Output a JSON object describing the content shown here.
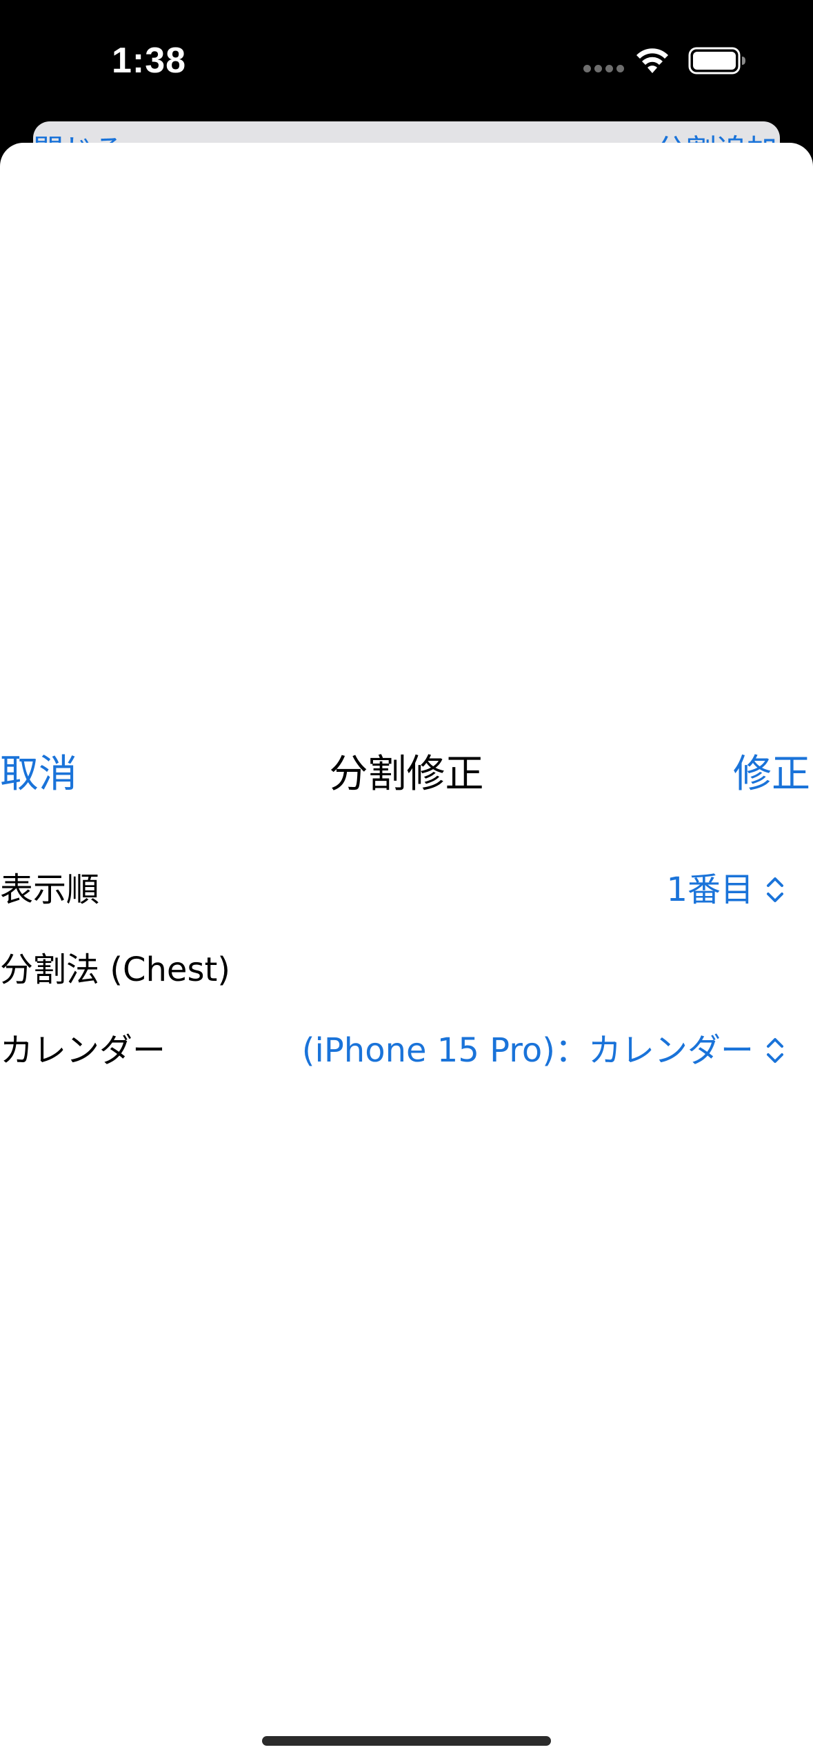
{
  "status_bar": {
    "time": "1:38",
    "wifi_icon": "wifi-icon",
    "battery_icon": "battery-icon"
  },
  "back_sheet": {
    "left_button": "閉じる",
    "right_button": "分割追加"
  },
  "nav": {
    "cancel_label": "取消",
    "title": "分割修正",
    "confirm_label": "修正"
  },
  "form": {
    "display_order": {
      "label": "表示順",
      "value": "1番目",
      "icon": "chevron-updown-icon"
    },
    "split_method": {
      "label": "分割法  (Chest)"
    },
    "calendar": {
      "label": "カレンダー",
      "value": "(iPhone 15 Pro)：カレンダー",
      "icon": "chevron-updown-icon"
    }
  },
  "colors": {
    "accent": "#1a73d9",
    "text": "#000000",
    "sheet_background": "#ffffff",
    "back_sheet_background": "#e3e3e6",
    "status_bar_background": "#000000"
  }
}
